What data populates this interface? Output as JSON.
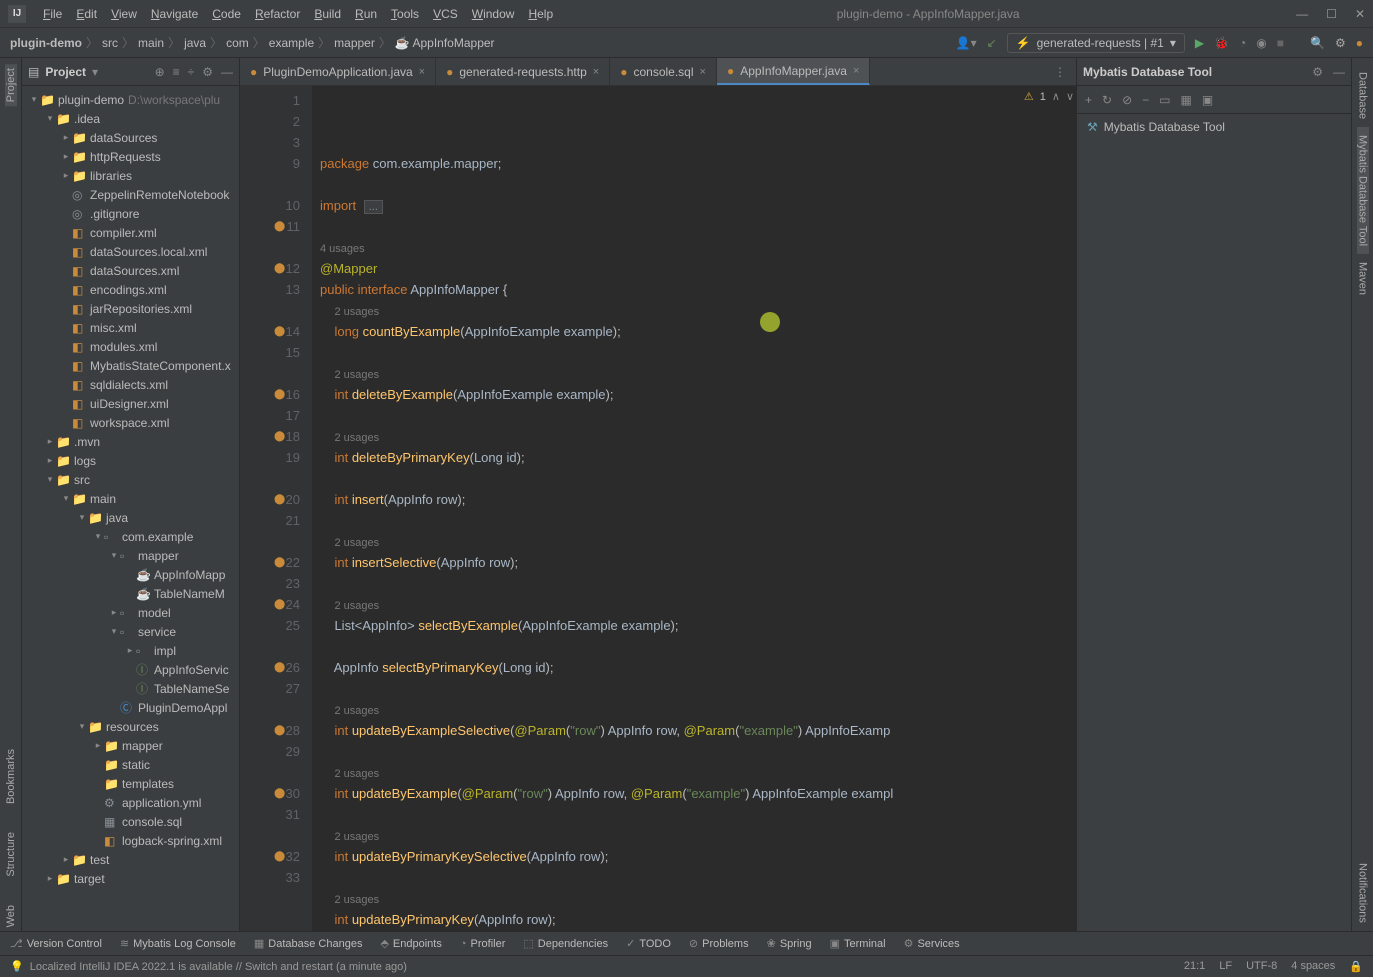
{
  "window": {
    "title": "plugin-demo - AppInfoMapper.java"
  },
  "menu": [
    "File",
    "Edit",
    "View",
    "Navigate",
    "Code",
    "Refactor",
    "Build",
    "Run",
    "Tools",
    "VCS",
    "Window",
    "Help"
  ],
  "breadcrumb": [
    "plugin-demo",
    "src",
    "main",
    "java",
    "com",
    "example",
    "mapper",
    "AppInfoMapper"
  ],
  "runConfig": "generated-requests | #1",
  "projectPanel": {
    "title": "Project",
    "root": {
      "name": "plugin-demo",
      "path": "D:\\workspace\\plu"
    }
  },
  "tree": [
    {
      "depth": 0,
      "arrow": "v",
      "icon": "project",
      "name": "plugin-demo",
      "path": "D:\\workspace\\plu"
    },
    {
      "depth": 1,
      "arrow": "v",
      "icon": "folder",
      "name": ".idea"
    },
    {
      "depth": 2,
      "arrow": ">",
      "icon": "folder",
      "name": "dataSources"
    },
    {
      "depth": 2,
      "arrow": ">",
      "icon": "folder",
      "name": "httpRequests"
    },
    {
      "depth": 2,
      "arrow": ">",
      "icon": "folder",
      "name": "libraries"
    },
    {
      "depth": 2,
      "arrow": "",
      "icon": "file",
      "name": "ZeppelinRemoteNotebook"
    },
    {
      "depth": 2,
      "arrow": "",
      "icon": "file",
      "name": ".gitignore"
    },
    {
      "depth": 2,
      "arrow": "",
      "icon": "xml",
      "name": "compiler.xml"
    },
    {
      "depth": 2,
      "arrow": "",
      "icon": "xml",
      "name": "dataSources.local.xml"
    },
    {
      "depth": 2,
      "arrow": "",
      "icon": "xml",
      "name": "dataSources.xml"
    },
    {
      "depth": 2,
      "arrow": "",
      "icon": "xml",
      "name": "encodings.xml"
    },
    {
      "depth": 2,
      "arrow": "",
      "icon": "xml",
      "name": "jarRepositories.xml"
    },
    {
      "depth": 2,
      "arrow": "",
      "icon": "xml",
      "name": "misc.xml"
    },
    {
      "depth": 2,
      "arrow": "",
      "icon": "xml",
      "name": "modules.xml"
    },
    {
      "depth": 2,
      "arrow": "",
      "icon": "xml",
      "name": "MybatisStateComponent.x"
    },
    {
      "depth": 2,
      "arrow": "",
      "icon": "xml",
      "name": "sqldialects.xml"
    },
    {
      "depth": 2,
      "arrow": "",
      "icon": "xml",
      "name": "uiDesigner.xml"
    },
    {
      "depth": 2,
      "arrow": "",
      "icon": "xml",
      "name": "workspace.xml"
    },
    {
      "depth": 1,
      "arrow": ">",
      "icon": "folder",
      "name": ".mvn"
    },
    {
      "depth": 1,
      "arrow": ">",
      "icon": "folder",
      "name": "logs"
    },
    {
      "depth": 1,
      "arrow": "v",
      "icon": "folder-src",
      "name": "src"
    },
    {
      "depth": 2,
      "arrow": "v",
      "icon": "folder",
      "name": "main"
    },
    {
      "depth": 3,
      "arrow": "v",
      "icon": "folder-src",
      "name": "java"
    },
    {
      "depth": 4,
      "arrow": "v",
      "icon": "package",
      "name": "com.example"
    },
    {
      "depth": 5,
      "arrow": "v",
      "icon": "package",
      "name": "mapper"
    },
    {
      "depth": 6,
      "arrow": "",
      "icon": "java",
      "name": "AppInfoMapp"
    },
    {
      "depth": 6,
      "arrow": "",
      "icon": "java",
      "name": "TableNameM"
    },
    {
      "depth": 5,
      "arrow": ">",
      "icon": "package",
      "name": "model"
    },
    {
      "depth": 5,
      "arrow": "v",
      "icon": "package",
      "name": "service"
    },
    {
      "depth": 6,
      "arrow": ">",
      "icon": "package",
      "name": "impl"
    },
    {
      "depth": 6,
      "arrow": "",
      "icon": "interface",
      "name": "AppInfoServic"
    },
    {
      "depth": 6,
      "arrow": "",
      "icon": "interface",
      "name": "TableNameSe"
    },
    {
      "depth": 5,
      "arrow": "",
      "icon": "class",
      "name": "PluginDemoAppl"
    },
    {
      "depth": 3,
      "arrow": "v",
      "icon": "folder-res",
      "name": "resources"
    },
    {
      "depth": 4,
      "arrow": ">",
      "icon": "folder",
      "name": "mapper"
    },
    {
      "depth": 4,
      "arrow": "",
      "icon": "folder",
      "name": "static"
    },
    {
      "depth": 4,
      "arrow": "",
      "icon": "folder",
      "name": "templates"
    },
    {
      "depth": 4,
      "arrow": "",
      "icon": "yml",
      "name": "application.yml"
    },
    {
      "depth": 4,
      "arrow": "",
      "icon": "sql",
      "name": "console.sql"
    },
    {
      "depth": 4,
      "arrow": "",
      "icon": "xml",
      "name": "logback-spring.xml"
    },
    {
      "depth": 2,
      "arrow": ">",
      "icon": "folder",
      "name": "test"
    },
    {
      "depth": 1,
      "arrow": ">",
      "icon": "folder-target",
      "name": "target"
    }
  ],
  "tabs": [
    {
      "name": "PluginDemoApplication.java",
      "icon": "class",
      "active": false
    },
    {
      "name": "generated-requests.http",
      "icon": "http",
      "active": false
    },
    {
      "name": "console.sql",
      "icon": "sql",
      "active": false
    },
    {
      "name": "AppInfoMapper.java",
      "icon": "java",
      "active": true
    }
  ],
  "editor": {
    "warnCount": "1",
    "lines": [
      {
        "n": "1",
        "html": "<span class='kw'>package</span> <span class='type'>com.example.mapper</span>;"
      },
      {
        "n": "2",
        "html": ""
      },
      {
        "n": "3",
        "html": "<span class='kw'>import</span> <span class='fold'>...</span>",
        "fold": true
      },
      {
        "n": "9",
        "html": ""
      },
      {
        "n": "",
        "html": "<span class='usage'>4 usages</span>"
      },
      {
        "n": "10",
        "html": "<span class='anno'>@Mapper</span>"
      },
      {
        "n": "11",
        "html": "<span class='kw'>public interface</span> <span class='type'>AppInfoMapper</span> {",
        "gi": "nav"
      },
      {
        "n": "",
        "html": "    <span class='usage'>2 usages</span>"
      },
      {
        "n": "12",
        "html": "    <span class='kw'>long</span> <span class='method'>countByExample</span>(<span class='type'>AppInfoExample</span> <span class='param'>example</span>);",
        "gi": "nav"
      },
      {
        "n": "13",
        "html": ""
      },
      {
        "n": "",
        "html": "    <span class='usage'>2 usages</span>"
      },
      {
        "n": "14",
        "html": "    <span class='kw'>int</span> <span class='method'>deleteByExample</span>(<span class='type'>AppInfoExample</span> <span class='param'>example</span>);",
        "gi": "nav"
      },
      {
        "n": "15",
        "html": ""
      },
      {
        "n": "",
        "html": "    <span class='usage'>2 usages</span>"
      },
      {
        "n": "16",
        "html": "    <span class='kw'>int</span> <span class='method'>deleteByPrimaryKey</span>(<span class='type'>Long</span> <span class='param'>id</span>);",
        "gi": "nav"
      },
      {
        "n": "17",
        "html": ""
      },
      {
        "n": "18",
        "html": "    <span class='kw'>int</span> <span class='method'>insert</span>(<span class='type'>AppInfo</span> <span class='param'>row</span>);",
        "gi": "nav"
      },
      {
        "n": "19",
        "html": ""
      },
      {
        "n": "",
        "html": "    <span class='usage'>2 usages</span>"
      },
      {
        "n": "20",
        "html": "    <span class='kw'>int</span> <span class='method'>insertSelective</span>(<span class='type'>AppInfo</span> <span class='param'>row</span>);",
        "gi": "nav"
      },
      {
        "n": "21",
        "html": ""
      },
      {
        "n": "",
        "html": "    <span class='usage'>2 usages</span>"
      },
      {
        "n": "22",
        "html": "    <span class='type'>List&lt;AppInfo&gt;</span> <span class='method'>selectByExample</span>(<span class='type'>AppInfoExample</span> <span class='param'>example</span>);",
        "gi": "nav"
      },
      {
        "n": "23",
        "html": ""
      },
      {
        "n": "24",
        "html": "    <span class='type'>AppInfo</span> <span class='method'>selectByPrimaryKey</span>(<span class='type'>Long</span> <span class='param'>id</span>);",
        "gi": "nav"
      },
      {
        "n": "25",
        "html": ""
      },
      {
        "n": "",
        "html": "    <span class='usage'>2 usages</span>"
      },
      {
        "n": "26",
        "html": "    <span class='kw'>int</span> <span class='method'>updateByExampleSelective</span>(<span class='anno'>@Param</span>(<span class='string'>\"row\"</span>) <span class='type'>AppInfo</span> <span class='param'>row</span>, <span class='anno'>@Param</span>(<span class='string'>\"example\"</span>) <span class='type'>AppInfoExamp</span>",
        "gi": "nav"
      },
      {
        "n": "27",
        "html": ""
      },
      {
        "n": "",
        "html": "    <span class='usage'>2 usages</span>"
      },
      {
        "n": "28",
        "html": "    <span class='kw'>int</span> <span class='method'>updateByExample</span>(<span class='anno'>@Param</span>(<span class='string'>\"row\"</span>) <span class='type'>AppInfo</span> <span class='param'>row</span>, <span class='anno'>@Param</span>(<span class='string'>\"example\"</span>) <span class='type'>AppInfoExample</span> <span class='param'>exampl</span>",
        "gi": "nav"
      },
      {
        "n": "29",
        "html": ""
      },
      {
        "n": "",
        "html": "    <span class='usage'>2 usages</span>"
      },
      {
        "n": "30",
        "html": "    <span class='kw'>int</span> <span class='method'>updateByPrimaryKeySelective</span>(<span class='type'>AppInfo</span> <span class='param'>row</span>);",
        "gi": "nav"
      },
      {
        "n": "31",
        "html": ""
      },
      {
        "n": "",
        "html": "    <span class='usage'>2 usages</span>"
      },
      {
        "n": "32",
        "html": "    <span class='kw'>int</span> <span class='method'>updateByPrimaryKey</span>(<span class='type'>AppInfo</span> <span class='param'>row</span>);",
        "gi": "nav"
      },
      {
        "n": "33",
        "html": ""
      }
    ]
  },
  "rightPanel": {
    "title": "Mybatis Database Tool",
    "item": "Mybatis Database Tool"
  },
  "rightGutter": [
    "Database",
    "Mybatis Database Tool",
    "Maven",
    "Notifications"
  ],
  "leftGutter": [
    "Project",
    "Bookmarks",
    "Structure",
    "Web"
  ],
  "bottomTools": [
    "Version Control",
    "Mybatis Log Console",
    "Database Changes",
    "Endpoints",
    "Profiler",
    "Dependencies",
    "TODO",
    "Problems",
    "Spring",
    "Terminal",
    "Services"
  ],
  "status": {
    "msg": "Localized IntelliJ IDEA 2022.1 is available // Switch and restart (a minute ago)",
    "pos": "21:1",
    "lf": "LF",
    "enc": "UTF-8",
    "indent": "4 spaces"
  }
}
